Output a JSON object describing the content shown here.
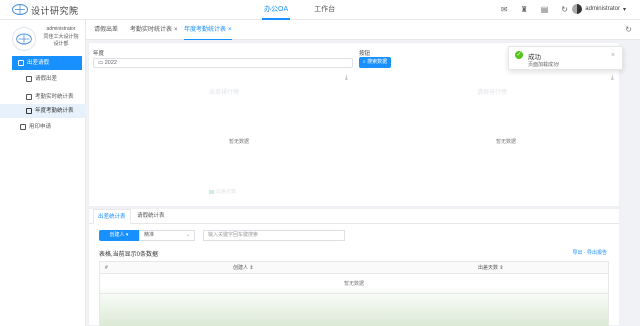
{
  "app": {
    "brand": "设计研究院",
    "nav": [
      {
        "label": "办公OA",
        "active": true
      },
      {
        "label": "工作台",
        "active": false
      }
    ],
    "user": "administrator"
  },
  "sidebar": {
    "profile": {
      "name": "administrator",
      "org": "同佳工大设计院",
      "dept": "设计部"
    },
    "items": [
      {
        "label": "出差请假",
        "level": 1,
        "state": "active-parent"
      },
      {
        "label": "请假出差",
        "level": 2,
        "state": ""
      },
      {
        "label": "考勤实时统计表",
        "level": 2,
        "state": ""
      },
      {
        "label": "年度考勤统计表",
        "level": 2,
        "state": "selected"
      },
      {
        "label": "用印申请",
        "level": 1,
        "state": ""
      }
    ]
  },
  "tabs": [
    {
      "label": "请假出差",
      "closable": false,
      "active": false
    },
    {
      "label": "考勤实时统计表",
      "closable": true,
      "active": false
    },
    {
      "label": "年度考勤统计表",
      "closable": true,
      "active": true
    }
  ],
  "filter": {
    "year_label": "年度",
    "year_value": "2022",
    "action_label": "按钮",
    "query_button": "搜索数据"
  },
  "charts": [
    {
      "title": "出差排行榜",
      "empty": "暂无数据",
      "legend": "出差天数"
    },
    {
      "title": "请假排行榜",
      "empty": "暂无数据"
    }
  ],
  "stats": {
    "tabs": [
      "出差统计表",
      "请假统计表"
    ],
    "creator_button": "创建人 ▾",
    "match_value": "精准",
    "keyword_placeholder": "输入关键字回车键搜索",
    "table_caption": "表格,当前显示0条数据",
    "actions": "导出 · 导出报告",
    "columns": [
      "#",
      "创建人 ⇕",
      "出差天数 ⇕"
    ],
    "empty_text": "暂无数据"
  },
  "toast": {
    "title": "成功",
    "message": "页面加载成功!"
  },
  "colors": {
    "accent": "#1890ff",
    "success": "#52c41a"
  }
}
